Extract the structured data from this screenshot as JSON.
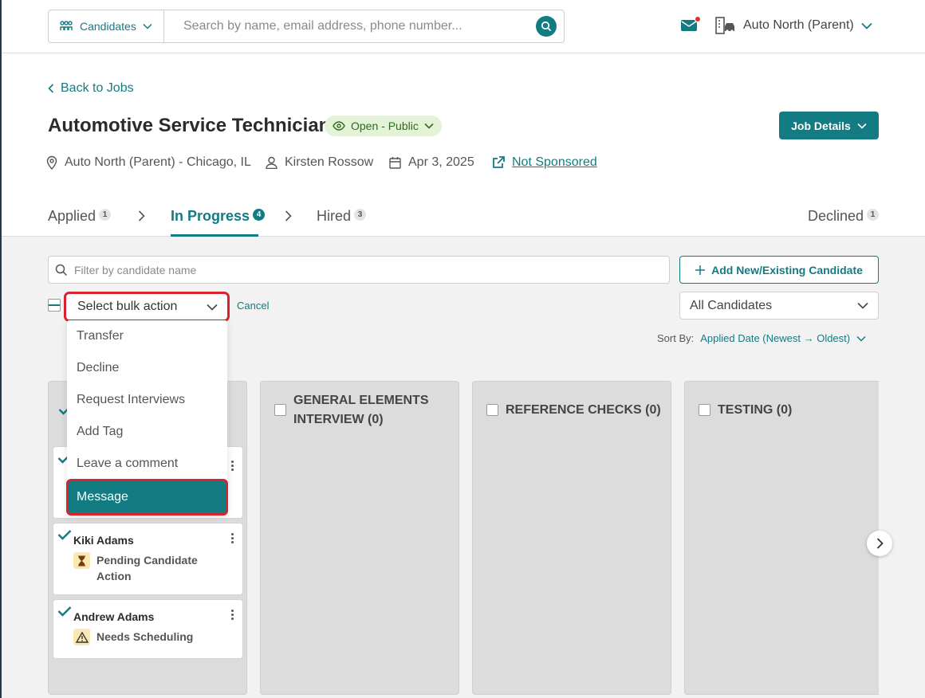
{
  "topbar": {
    "scope_label": "Candidates",
    "search_placeholder": "Search by name, email address, phone number...",
    "org_name": "Auto North (Parent)"
  },
  "header": {
    "back_label": "Back to Jobs",
    "job_title": "Automotive Service Technician",
    "status_label": "Open - Public",
    "details_button": "Job Details",
    "location": "Auto North (Parent) - Chicago, IL",
    "recruiter": "Kirsten Rossow",
    "date": "Apr 3, 2025",
    "sponsorship": "Not Sponsored"
  },
  "tabs": [
    {
      "label": "Applied",
      "count": "1"
    },
    {
      "label": "In Progress",
      "count": "4"
    },
    {
      "label": "Hired",
      "count": "3"
    },
    {
      "label": "Declined",
      "count": "1"
    }
  ],
  "toolbar": {
    "filter_placeholder": "Filter by candidate name",
    "add_candidate": "Add New/Existing Candidate",
    "bulk_placeholder": "Select bulk action",
    "cancel": "Cancel",
    "candidate_filter": "All Candidates",
    "sort_label": "Sort By:",
    "sort_value": "Applied Date (Newest → Oldest)"
  },
  "bulk_menu": [
    "Transfer",
    "Decline",
    "Request Interviews",
    "Add Tag",
    "Leave a comment",
    "Message"
  ],
  "columns": [
    {
      "title_line1": "GENERAL ELEMENTS",
      "title_line2": "INTERVIEW (0)"
    },
    {
      "title": "REFERENCE CHECKS (0)"
    },
    {
      "title": "TESTING (0)"
    }
  ],
  "cards": [
    {
      "name": "Kiki Adams",
      "status_line1": "Pending Candidate",
      "status_line2": "Action",
      "icon": "hourglass-icon"
    },
    {
      "name": "Andrew Adams",
      "status": "Needs Scheduling",
      "icon": "warning-icon"
    }
  ],
  "colors": {
    "accent": "#137b82",
    "highlight": "#d6252f",
    "status_green": "#e4f2d7",
    "warning_bg": "#fbe7b4"
  }
}
